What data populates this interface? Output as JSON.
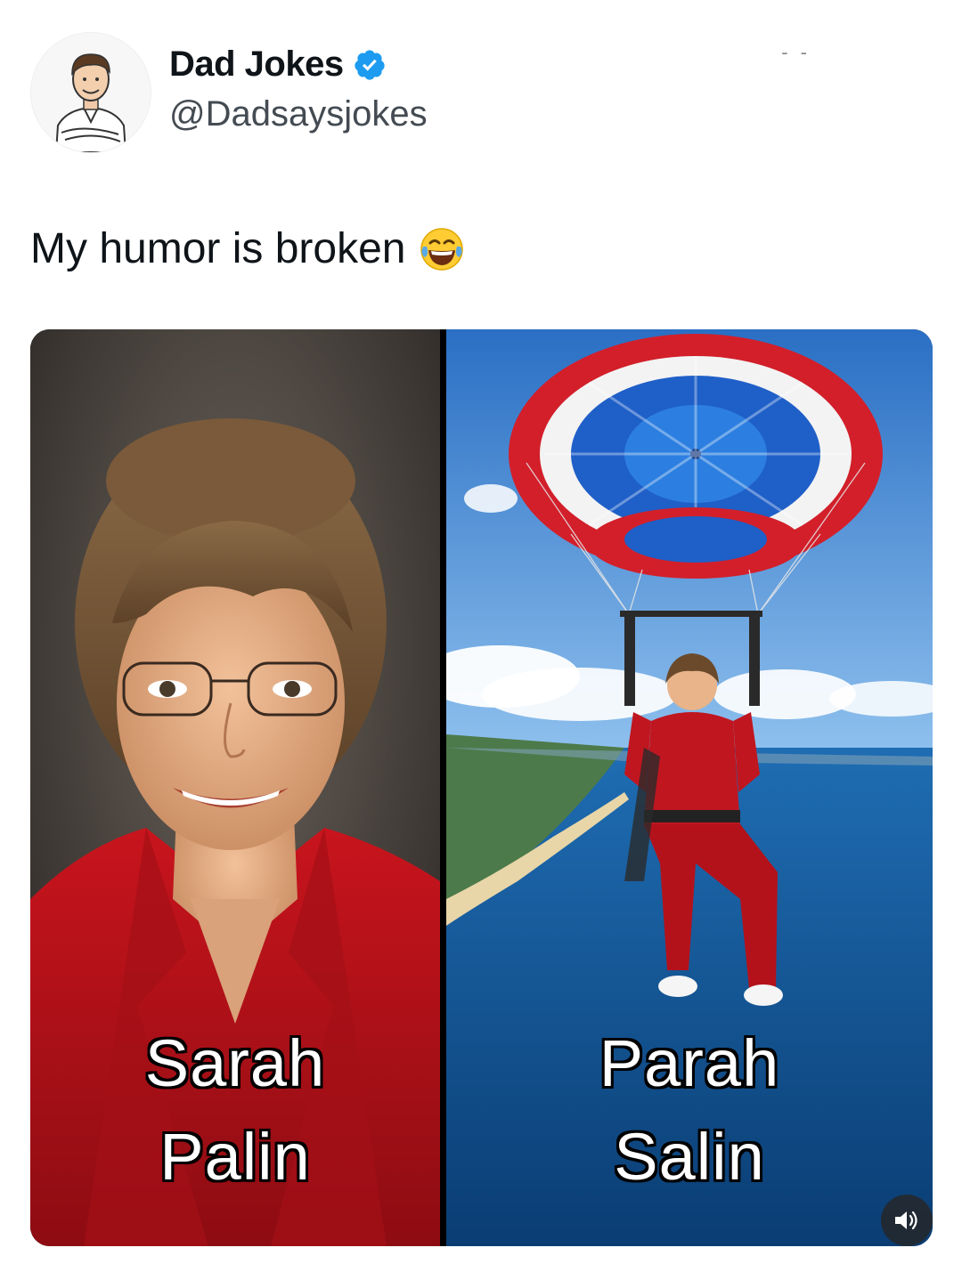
{
  "author": {
    "display_name": "Dad Jokes",
    "handle": "@Dadsaysjokes",
    "verified": true,
    "avatar_icon": "cartoon-man-avatar-icon"
  },
  "header": {
    "more_label": "- -"
  },
  "tweet": {
    "text": "My humor is broken",
    "emoji": "face-with-tears-of-joy-icon"
  },
  "media": {
    "left_caption": [
      "Sarah",
      "Palin"
    ],
    "right_caption": [
      "Parah",
      "Salin"
    ],
    "left_image": "portrait-photo",
    "right_image": "parasailing-photo",
    "volume_icon": "speaker-volume-icon"
  },
  "colors": {
    "verified_blue": "#1d9bf0",
    "suit_red": "#b3121b",
    "sky_blue": "#2f7fd0",
    "sea_blue": "#0f4f8c"
  }
}
